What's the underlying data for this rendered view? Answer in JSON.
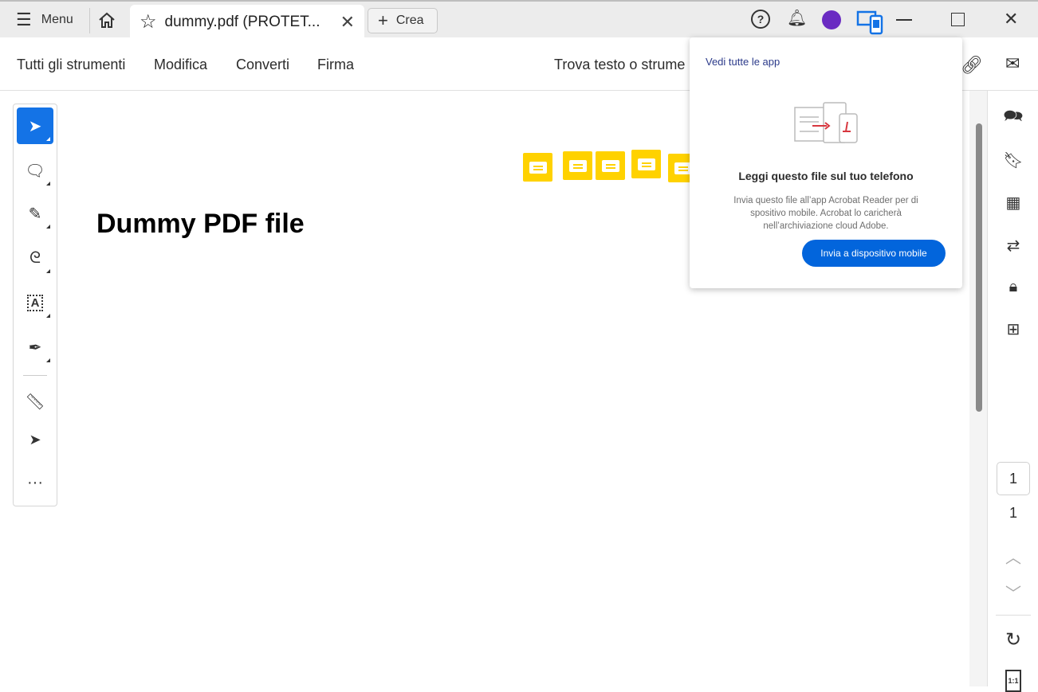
{
  "tabbar": {
    "menu_label": "Menu",
    "tab_title": "dummy.pdf (PROTET...",
    "create_label": "Crea"
  },
  "toolbar": {
    "items": [
      "Tutti gli strumenti",
      "Modifica",
      "Converti",
      "Firma"
    ],
    "search_placeholder": "Trova testo o strume"
  },
  "document": {
    "title": "Dummy PDF file"
  },
  "popup": {
    "link": "Vedi tutte le app",
    "heading": "Leggi questo file sul tuo telefono",
    "body_lines": [
      "Invia questo file all’app Acrobat Reader per di",
      "spositivo mobile. Acrobat lo caricherà",
      "nell’archiviazione cloud Adobe."
    ],
    "button": "Invia a dispositivo mobile"
  },
  "page_nav": {
    "current_page": "1",
    "total_pages": "1",
    "zoom_icon_label": "1:1"
  },
  "colors": {
    "accent": "#1473e6",
    "note": "#ffd200",
    "popup_button": "#0265dc"
  }
}
